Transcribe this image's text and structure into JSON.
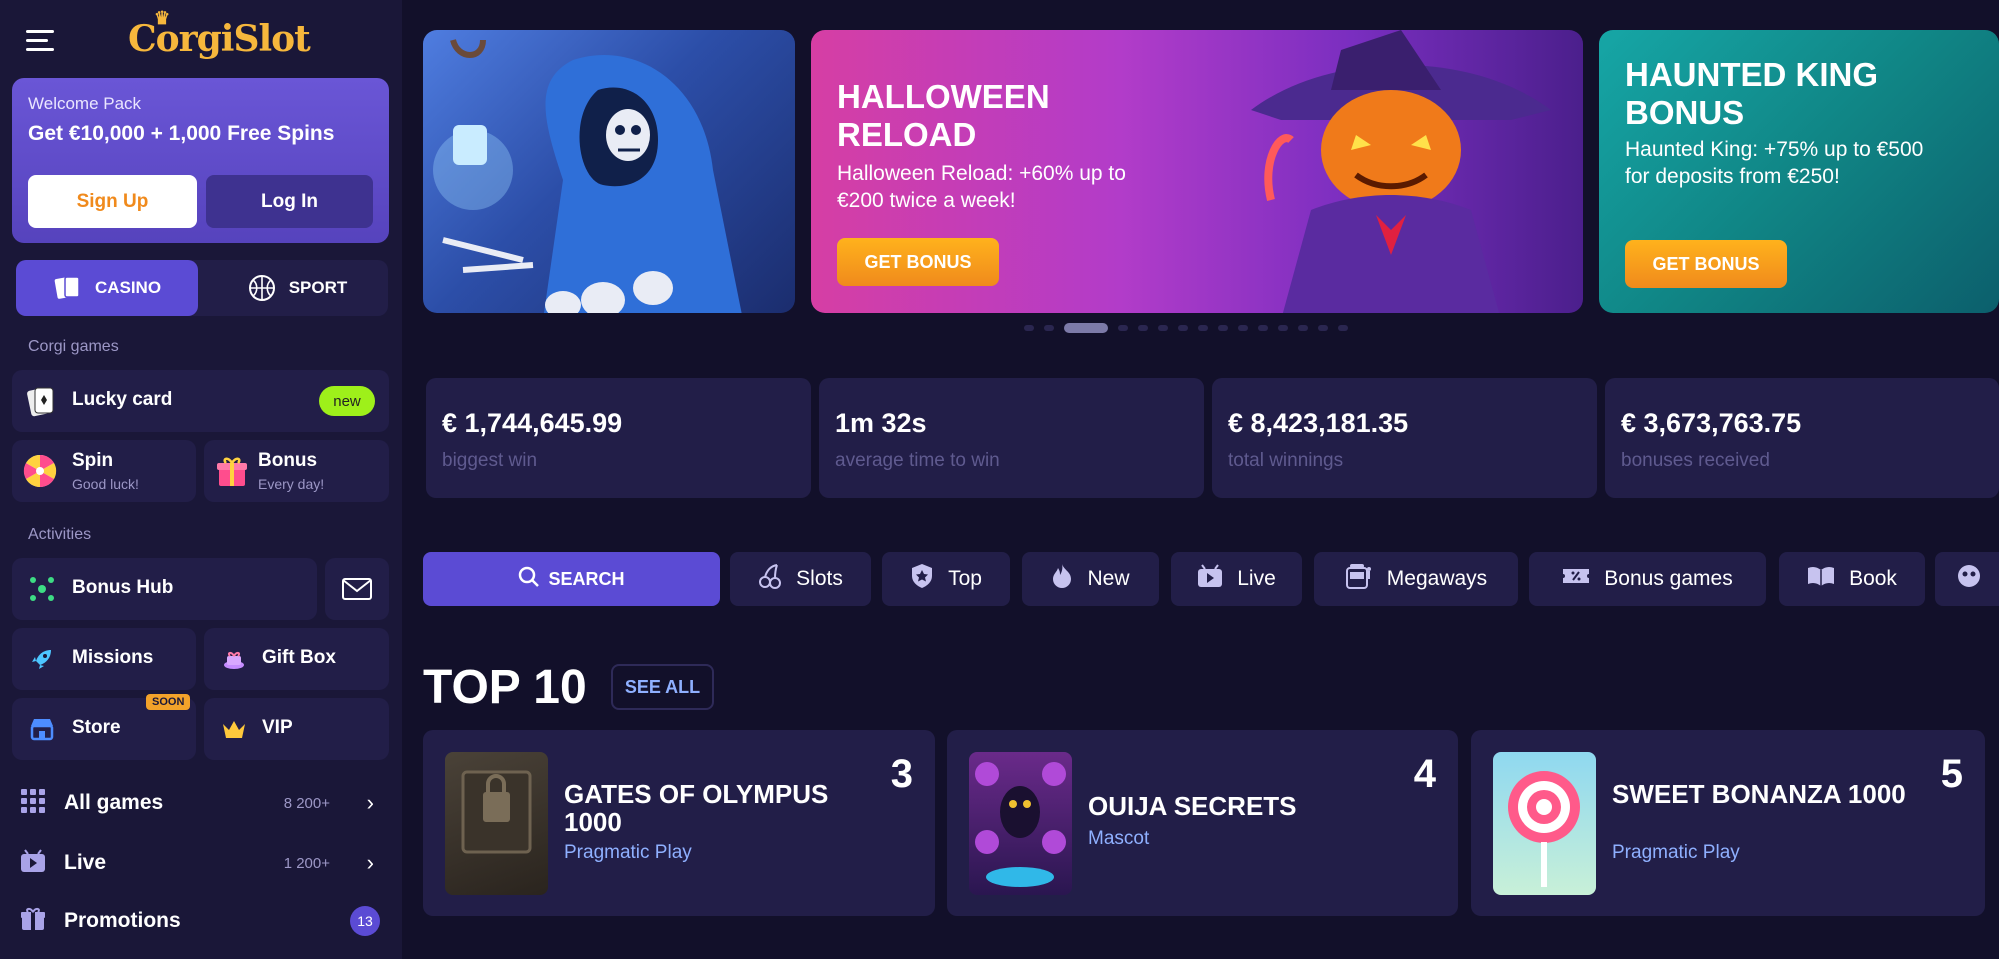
{
  "brand": {
    "logo": "CorgiSlot"
  },
  "welcome": {
    "title": "Welcome Pack",
    "offer": "Get €10,000 + 1,000 Free Spins",
    "signup": "Sign Up",
    "login": "Log In"
  },
  "modes": [
    {
      "label": "CASINO",
      "icon": "cards-icon"
    },
    {
      "label": "SPORT",
      "icon": "basketball-icon"
    }
  ],
  "sidebar": {
    "corgi_label": "Corgi games",
    "lucky": {
      "label": "Lucky card",
      "badge": "new"
    },
    "spin": {
      "label": "Spin",
      "sub": "Good luck!"
    },
    "bonus": {
      "label": "Bonus",
      "sub": "Every day!"
    },
    "activities_label": "Activities",
    "bonus_hub": "Bonus Hub",
    "missions": "Missions",
    "gift_box": "Gift Box",
    "store": {
      "label": "Store",
      "badge": "SOON"
    },
    "vip": "VIP",
    "nav": [
      {
        "label": "All games",
        "count": "8 200+"
      },
      {
        "label": "Live",
        "count": "1 200+"
      },
      {
        "label": "Promotions",
        "badge": "13"
      }
    ]
  },
  "banners": [
    {
      "title": "",
      "desc": "",
      "button": ""
    },
    {
      "title": "HALLOWEEN RELOAD",
      "desc": "Halloween Reload: +60% up to €200 twice a week!",
      "button": "GET BONUS"
    },
    {
      "title": "HAUNTED KING BONUS",
      "desc": "Haunted King: +75% up to €500 for deposits from €250!",
      "button": "GET BONUS"
    }
  ],
  "carousel": {
    "total": 15,
    "active": 2
  },
  "stats": [
    {
      "value": "€ 1,744,645.99",
      "label": "biggest win"
    },
    {
      "value": "1m 32s",
      "label": "average time to win"
    },
    {
      "value": "€ 8,423,181.35",
      "label": "total winnings"
    },
    {
      "value": "€ 3,673,763.75",
      "label": "bonuses received"
    }
  ],
  "search": {
    "label": "SEARCH"
  },
  "categories": [
    {
      "label": "Slots",
      "icon": "cherry-icon"
    },
    {
      "label": "Top",
      "icon": "shield-star-icon"
    },
    {
      "label": "New",
      "icon": "flame-icon"
    },
    {
      "label": "Live",
      "icon": "live-icon"
    },
    {
      "label": "Megaways",
      "icon": "slot-machine-icon"
    },
    {
      "label": "Bonus games",
      "icon": "ticket-icon"
    },
    {
      "label": "Book",
      "icon": "book-icon"
    }
  ],
  "top10": {
    "title": "TOP 10",
    "see_all": "SEE ALL"
  },
  "games": [
    {
      "rank": "3",
      "title": "GATES OF OLYMPUS 1000",
      "provider": "Pragmatic Play"
    },
    {
      "rank": "4",
      "title": "OUIJA SECRETS",
      "provider": "Mascot"
    },
    {
      "rank": "5",
      "title": "SWEET BONANZA 1000",
      "provider": "Pragmatic Play"
    }
  ],
  "colors": {
    "accent": "#5b4bd4",
    "cta": "#f6a21f",
    "bg": "#12102a",
    "panel": "#221e48"
  }
}
